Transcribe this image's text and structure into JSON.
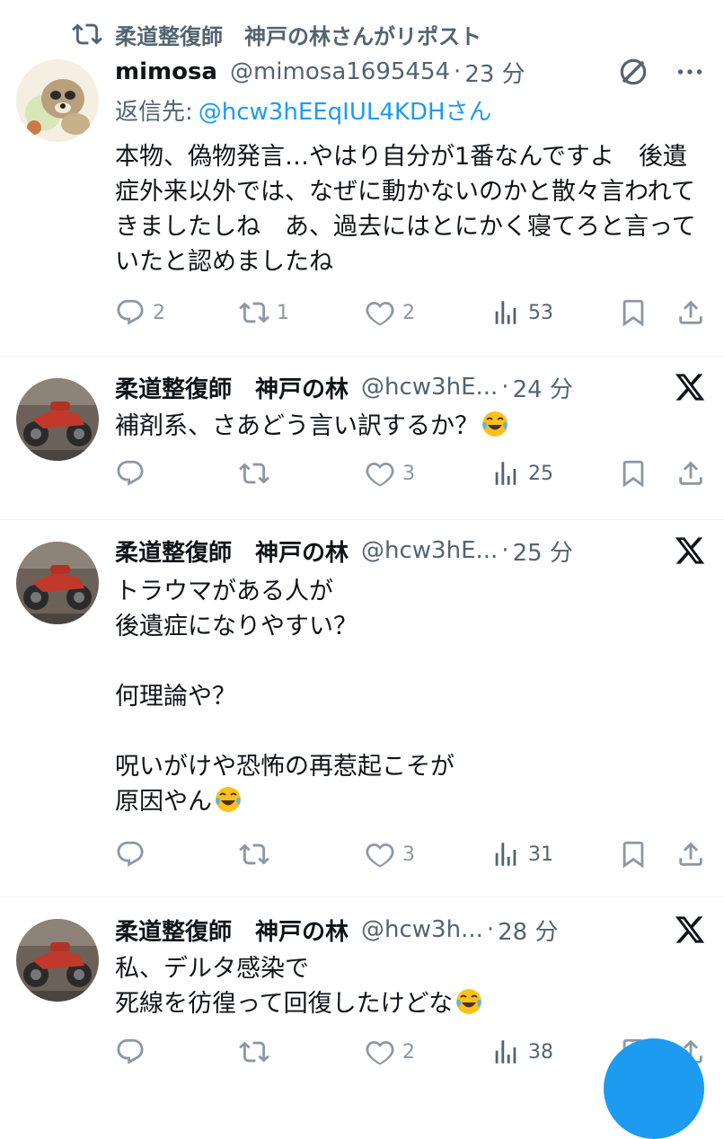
{
  "colors": {
    "accent": "#1d9bf0",
    "secondary_text": "#536471",
    "icon_grey": "#8b98a5",
    "divider": "#eff3f4"
  },
  "repost_banner": {
    "icon": "repost-icon",
    "text": "柔道整復師　神戸の林さんがリポスト"
  },
  "tweets": [
    {
      "name": "mimosa",
      "handle": "@mimosa1695454",
      "sep": "·",
      "time": "23 分",
      "reply_to_label": "返信先:",
      "reply_to_mention": "@hcw3hEEqIUL4KDHさん",
      "text": "本物、偽物発言…やはり自分が1番なんですよ　後遺症外来以外では、なぜに動かないのかと散々言われてきましたしね　あ、過去にはとにかく寝てろと言っていたと認めましたね",
      "reply_count": "2",
      "retweet_count": "1",
      "like_count": "2",
      "view_count": "53"
    },
    {
      "name": "柔道整復師　神戸の林",
      "handle": "@hcw3hE...",
      "sep": "·",
      "time": "24 分",
      "text": "補剤系、さあどう言い訳するか？",
      "reply_count": "",
      "retweet_count": "",
      "like_count": "3",
      "view_count": "25"
    },
    {
      "name": "柔道整復師　神戸の林",
      "handle": "@hcw3hE...",
      "sep": "·",
      "time": "25 分",
      "text": "トラウマがある人が\n後遺症になりやすい？\n\n何理論や？\n\n呪いがけや恐怖の再惹起こそが\n原因やん",
      "reply_count": "",
      "retweet_count": "",
      "like_count": "3",
      "view_count": "31"
    },
    {
      "name": "柔道整復師　神戸の林",
      "handle": "@hcw3h...",
      "sep": "·",
      "time": "28 分",
      "text": "私、デルタ感染で\n死線を彷徨って回復したけどな",
      "reply_count": "",
      "retweet_count": "",
      "like_count": "2",
      "view_count": "38"
    }
  ]
}
